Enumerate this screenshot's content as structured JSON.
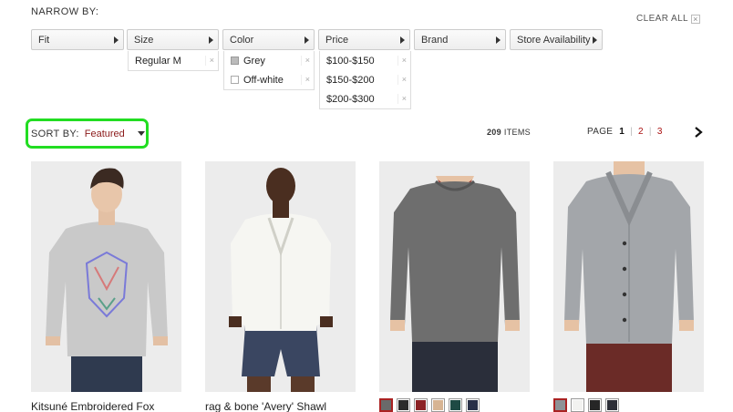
{
  "narrow_by": {
    "title": "NARROW BY:",
    "clear_all": "CLEAR ALL"
  },
  "filters": [
    {
      "label": "Fit"
    },
    {
      "label": "Size",
      "options": [
        {
          "label": "Regular M"
        }
      ]
    },
    {
      "label": "Color",
      "options": [
        {
          "label": "Grey",
          "checked": true
        },
        {
          "label": "Off-white",
          "checked": false
        }
      ]
    },
    {
      "label": "Price",
      "options": [
        {
          "label": "$100-$150"
        },
        {
          "label": "$150-$200"
        },
        {
          "label": "$200-$300"
        }
      ]
    },
    {
      "label": "Brand"
    },
    {
      "label": "Store Availability"
    }
  ],
  "sort": {
    "label": "SORT BY:",
    "value": "Featured"
  },
  "results": {
    "count": "209",
    "unit": "ITEMS"
  },
  "pager": {
    "label": "PAGE",
    "pages": [
      "1",
      "2",
      "3"
    ],
    "current": "1"
  },
  "products": [
    {
      "title": "Kitsuné Embroidered Fox",
      "top_color": "#c9c9c9",
      "bottom_color": "#2f3a4f"
    },
    {
      "title": "rag & bone 'Avery' Shawl",
      "top_color": "#f6f6f2",
      "bottom_color": "#3a4661"
    },
    {
      "title": "",
      "top_color": "#6e6e6e",
      "bottom_color": "#2a2e3a",
      "swatches": [
        "#6a6a6a",
        "#2b2b2b",
        "#8c2225",
        "#d7b493",
        "#1e4a44",
        "#283048"
      ],
      "selected_swatch": 0
    },
    {
      "title": "",
      "top_color": "#a3a6aa",
      "bottom_color": "#6b2b27",
      "swatches": [
        "#8e9296",
        "#f2f2f0",
        "#262626",
        "#2d2f38"
      ],
      "selected_swatch": 0
    }
  ]
}
